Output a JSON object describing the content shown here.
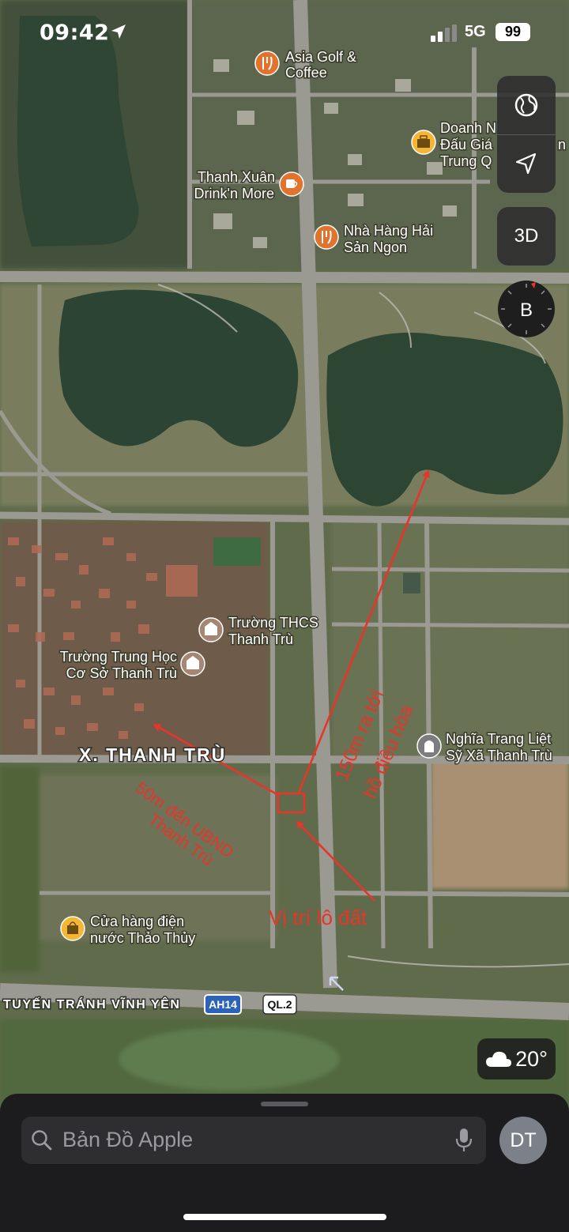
{
  "status_bar": {
    "time": "09:42",
    "network": "5G",
    "battery": "99"
  },
  "map": {
    "pois": [
      {
        "id": "asia-golf",
        "lines": [
          "Asia Golf &",
          "Coffee"
        ],
        "icon": "fork-knife-icon"
      },
      {
        "id": "doanh-nghiep",
        "lines": [
          "Doanh N",
          "Đấu Giá",
          "Trung Q"
        ],
        "icon": "briefcase-icon",
        "line_ends": [
          "",
          "n",
          ""
        ]
      },
      {
        "id": "thanh-xuan",
        "lines": [
          "Thanh Xuân",
          "Drink'n More"
        ],
        "icon": "cup-icon"
      },
      {
        "id": "nha-hang",
        "lines": [
          "Nhà Hàng Hải",
          "Sản Ngon"
        ],
        "icon": "fork-knife-icon"
      },
      {
        "id": "thcs-thanh-tru",
        "lines": [
          "Trường THCS",
          "Thanh Trù"
        ],
        "icon": "school-icon"
      },
      {
        "id": "trung-hoc",
        "lines": [
          "Trường Trung Học",
          "Cơ Sở Thanh Trù"
        ],
        "icon": "school-icon"
      },
      {
        "id": "nghia-trang",
        "lines": [
          "Nghĩa Trang Liệt",
          "Sỹ Xã Thanh Trù"
        ],
        "icon": "cemetery-icon"
      },
      {
        "id": "cua-hang",
        "lines": [
          "Cửa hàng điện",
          "nước Thảo Thủy"
        ],
        "icon": "bag-icon"
      }
    ],
    "area_label": "X. THANH TRÙ",
    "road_label": "TUYẾN TRÁNH VĨNH YÊN",
    "road_shields": [
      "AH14",
      "QL.2"
    ]
  },
  "annotations": {
    "lake_note": [
      "150m ra tới",
      "hồ điều hòa"
    ],
    "office_note": [
      "50m đến UBND",
      "Thanh Trù"
    ],
    "plot_note": "Vị trí lô đất",
    "color": "#e8342a"
  },
  "controls": {
    "three_d": "3D",
    "compass": "B"
  },
  "weather": {
    "temp": "20°"
  },
  "search": {
    "placeholder": "Bản Đồ Apple"
  },
  "avatar": {
    "initials": "DT"
  }
}
